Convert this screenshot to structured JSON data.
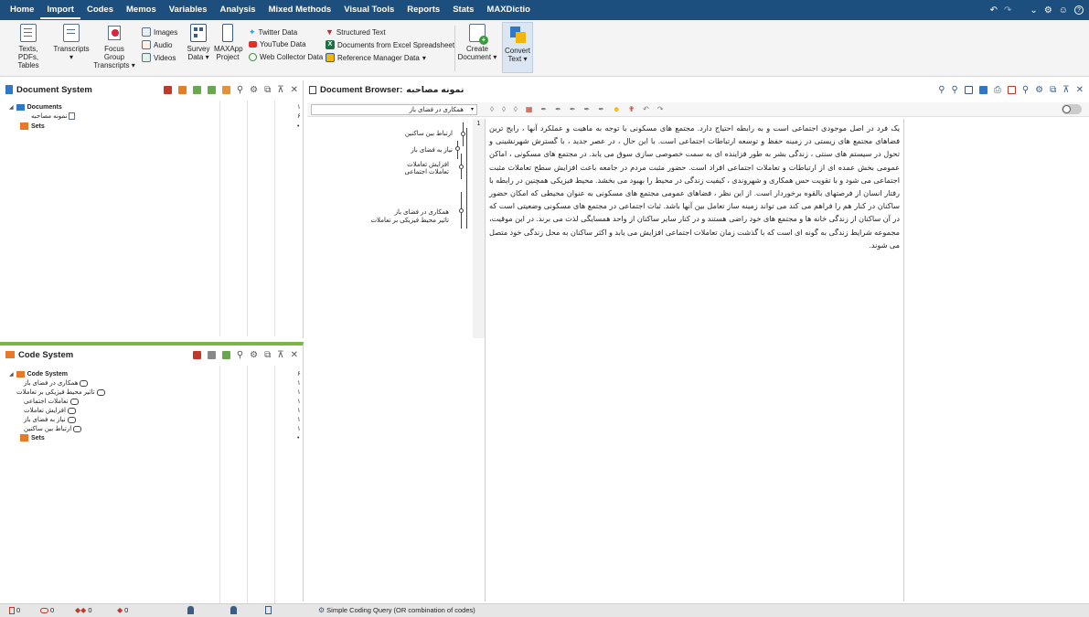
{
  "menubar": {
    "tabs": [
      "Home",
      "Import",
      "Codes",
      "Memos",
      "Variables",
      "Analysis",
      "Mixed Methods",
      "Visual Tools",
      "Reports",
      "Stats",
      "MAXDictio"
    ],
    "active_tab": "Import",
    "icons": [
      "undo-icon",
      "redo-icon",
      "chevron-down-icon",
      "gear-icon",
      "smiley-icon",
      "help-icon"
    ]
  },
  "ribbon": {
    "texts_pdfs": "Texts, PDFs,",
    "tables": "Tables",
    "transcripts": "Transcripts",
    "focus_group": "Focus Group",
    "focus_group_2": "Transcripts",
    "images": "Images",
    "audio": "Audio",
    "videos": "Videos",
    "survey": "Survey",
    "survey_2": "Data",
    "maxapp": "MAXApp",
    "maxapp_2": "Project",
    "twitter": "Twitter Data",
    "youtube": "YouTube Data",
    "webcollector": "Web Collector Data",
    "structured": "Structured Text",
    "excel": "Documents from Excel Spreadsheet",
    "refmanager": "Reference Manager Data",
    "create": "Create",
    "create_2": "Document",
    "convert": "Convert",
    "convert_2": "Text"
  },
  "document_system": {
    "title": "Document System",
    "rows": [
      {
        "label": "Documents",
        "count": "۱"
      },
      {
        "label": "نمونه مصاحبه",
        "count": "۶"
      },
      {
        "label": "Sets",
        "count": "•"
      }
    ]
  },
  "code_system": {
    "title": "Code System",
    "rows": [
      {
        "label": "Code System",
        "count": "۶"
      },
      {
        "label": "همکاری در فضای باز",
        "count": "۱"
      },
      {
        "label": "تاثیر محیط فیزیکی بر تعاملات",
        "count": "۱"
      },
      {
        "label": "تعاملات اجتماعی",
        "count": "۱"
      },
      {
        "label": "افزایش تعاملات",
        "count": "۱"
      },
      {
        "label": "نیاز به فضای باز",
        "count": "۱"
      },
      {
        "label": "ارتباط بین ساکنین",
        "count": "۱"
      },
      {
        "label": "Sets",
        "count": "•"
      }
    ]
  },
  "document_browser": {
    "title_prefix": "Document Browser:",
    "doc_name": "نمونه مصاحبه",
    "code_filter": "همکاری در فضای باز",
    "line_number": "1",
    "margin_codes": [
      "ارتباط بین ساکنین",
      "نیاز به فضای باز",
      "افزایش تعاملات",
      "تعاملات اجتماعی",
      "همکاری در فضای باز",
      "تاثیر محیط فیزیکی بر تعاملات"
    ],
    "text": "یک فرد در اصل موجودی اجتماعی است و به رابطه احتیاج دارد. مجتمع های مسکونی با توجه به ماهیت و عملکرد آنها ، رایج ترین فضاهای مجتمع های زیستی در زمینه حفظ و توسعه ارتباطات اجتماعی است. با این حال ، در عصر جدید ، با گسترش شهرنشینی و تحول در سیستم های سنتی ، زندگی بشر به طور فزاینده ای به سمت خصوصی سازی سوق می یابد. در مجتمع های مسکونی ، اماکن عمومی بخش عمده ای از ارتباطات و تعاملات اجتماعی افراد است. حضور مثبت مردم در جامعه باعث افزایش سطح تعاملات مثبت اجتماعی می شود و با تقویت حس همکاری و شهروندی ، کیفیت زندگی در محیط را بهبود می بخشد. محیط فیزیکی همچنین در رابطه با رفتار انسان از فرصتهای بالقوه برخوردار است. از این نظر ، فضاهای عمومی مجتمع های مسکونی به عنوان محیطی که امکان حضور ساکنان در کنار هم را فراهم می کند می تواند زمینه ساز تعامل بین آنها باشد. ثبات اجتماعی در مجتمع های مسکونی وضعیتی است که در آن ساکنان از زندگی خانه ها و مجتمع های خود راضی هستند و در کنار سایر ساکنان از واحد همسایگی لذت می برند. در این موقیت، مجموعه شرایط زندگی به گونه ای است که با گذشت زمان تعاملات اجتماعی افزایش می یابد و اکثر ساکنان به محل زندگی خود متصل می شوند."
  },
  "statusbar": {
    "counts": [
      "0",
      "0",
      "0",
      "0"
    ],
    "query": "Simple Coding Query (OR combination of codes)"
  },
  "colors": {
    "menubar": "#1d4f7e",
    "code_system_accent": "#7ab648",
    "code_folder": "#e8782a",
    "doc_folder": "#2f77c7"
  }
}
